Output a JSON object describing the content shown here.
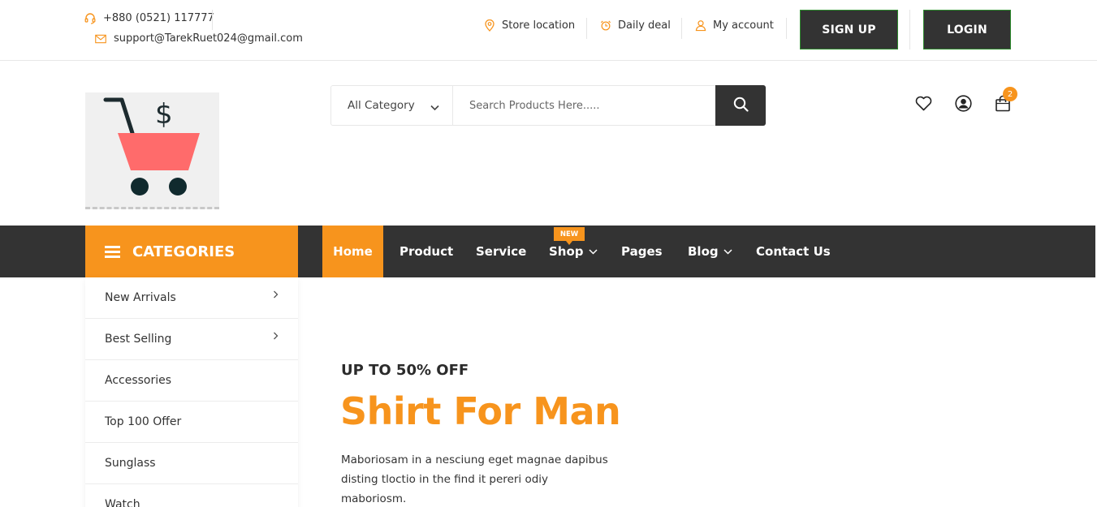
{
  "topbar": {
    "phone": "+880 (0521) 117777",
    "email": "support@TarekRuet024@gmail.com",
    "links": {
      "store": "Store location",
      "deal": "Daily deal",
      "account": "My account"
    },
    "signup_label": "SIGN UP",
    "login_label": "LOGIN"
  },
  "search": {
    "category_label": "All Category",
    "placeholder": "Search Products Here....."
  },
  "header": {
    "cart_count": "2"
  },
  "colors": {
    "accent": "#f7941d",
    "dark": "#333333",
    "logo_cart": "#ff6b6b"
  },
  "nav": {
    "categories_label": "CATEGORIES",
    "items": [
      "Home",
      "Product",
      "Service",
      "Shop",
      "Pages",
      "Blog",
      "Contact Us"
    ],
    "new_badge": "NEW"
  },
  "categories": [
    "New Arrivals",
    "Best Selling",
    "Accessories",
    "Top 100 Offer",
    "Sunglass",
    "Watch"
  ],
  "hero": {
    "subtitle": "UP TO 50% OFF",
    "title": "Shirt For Man",
    "description": "Maboriosam in a nesciung eget magnae dapibus disting tloctio in the find it pereri odiy maboriosm."
  }
}
